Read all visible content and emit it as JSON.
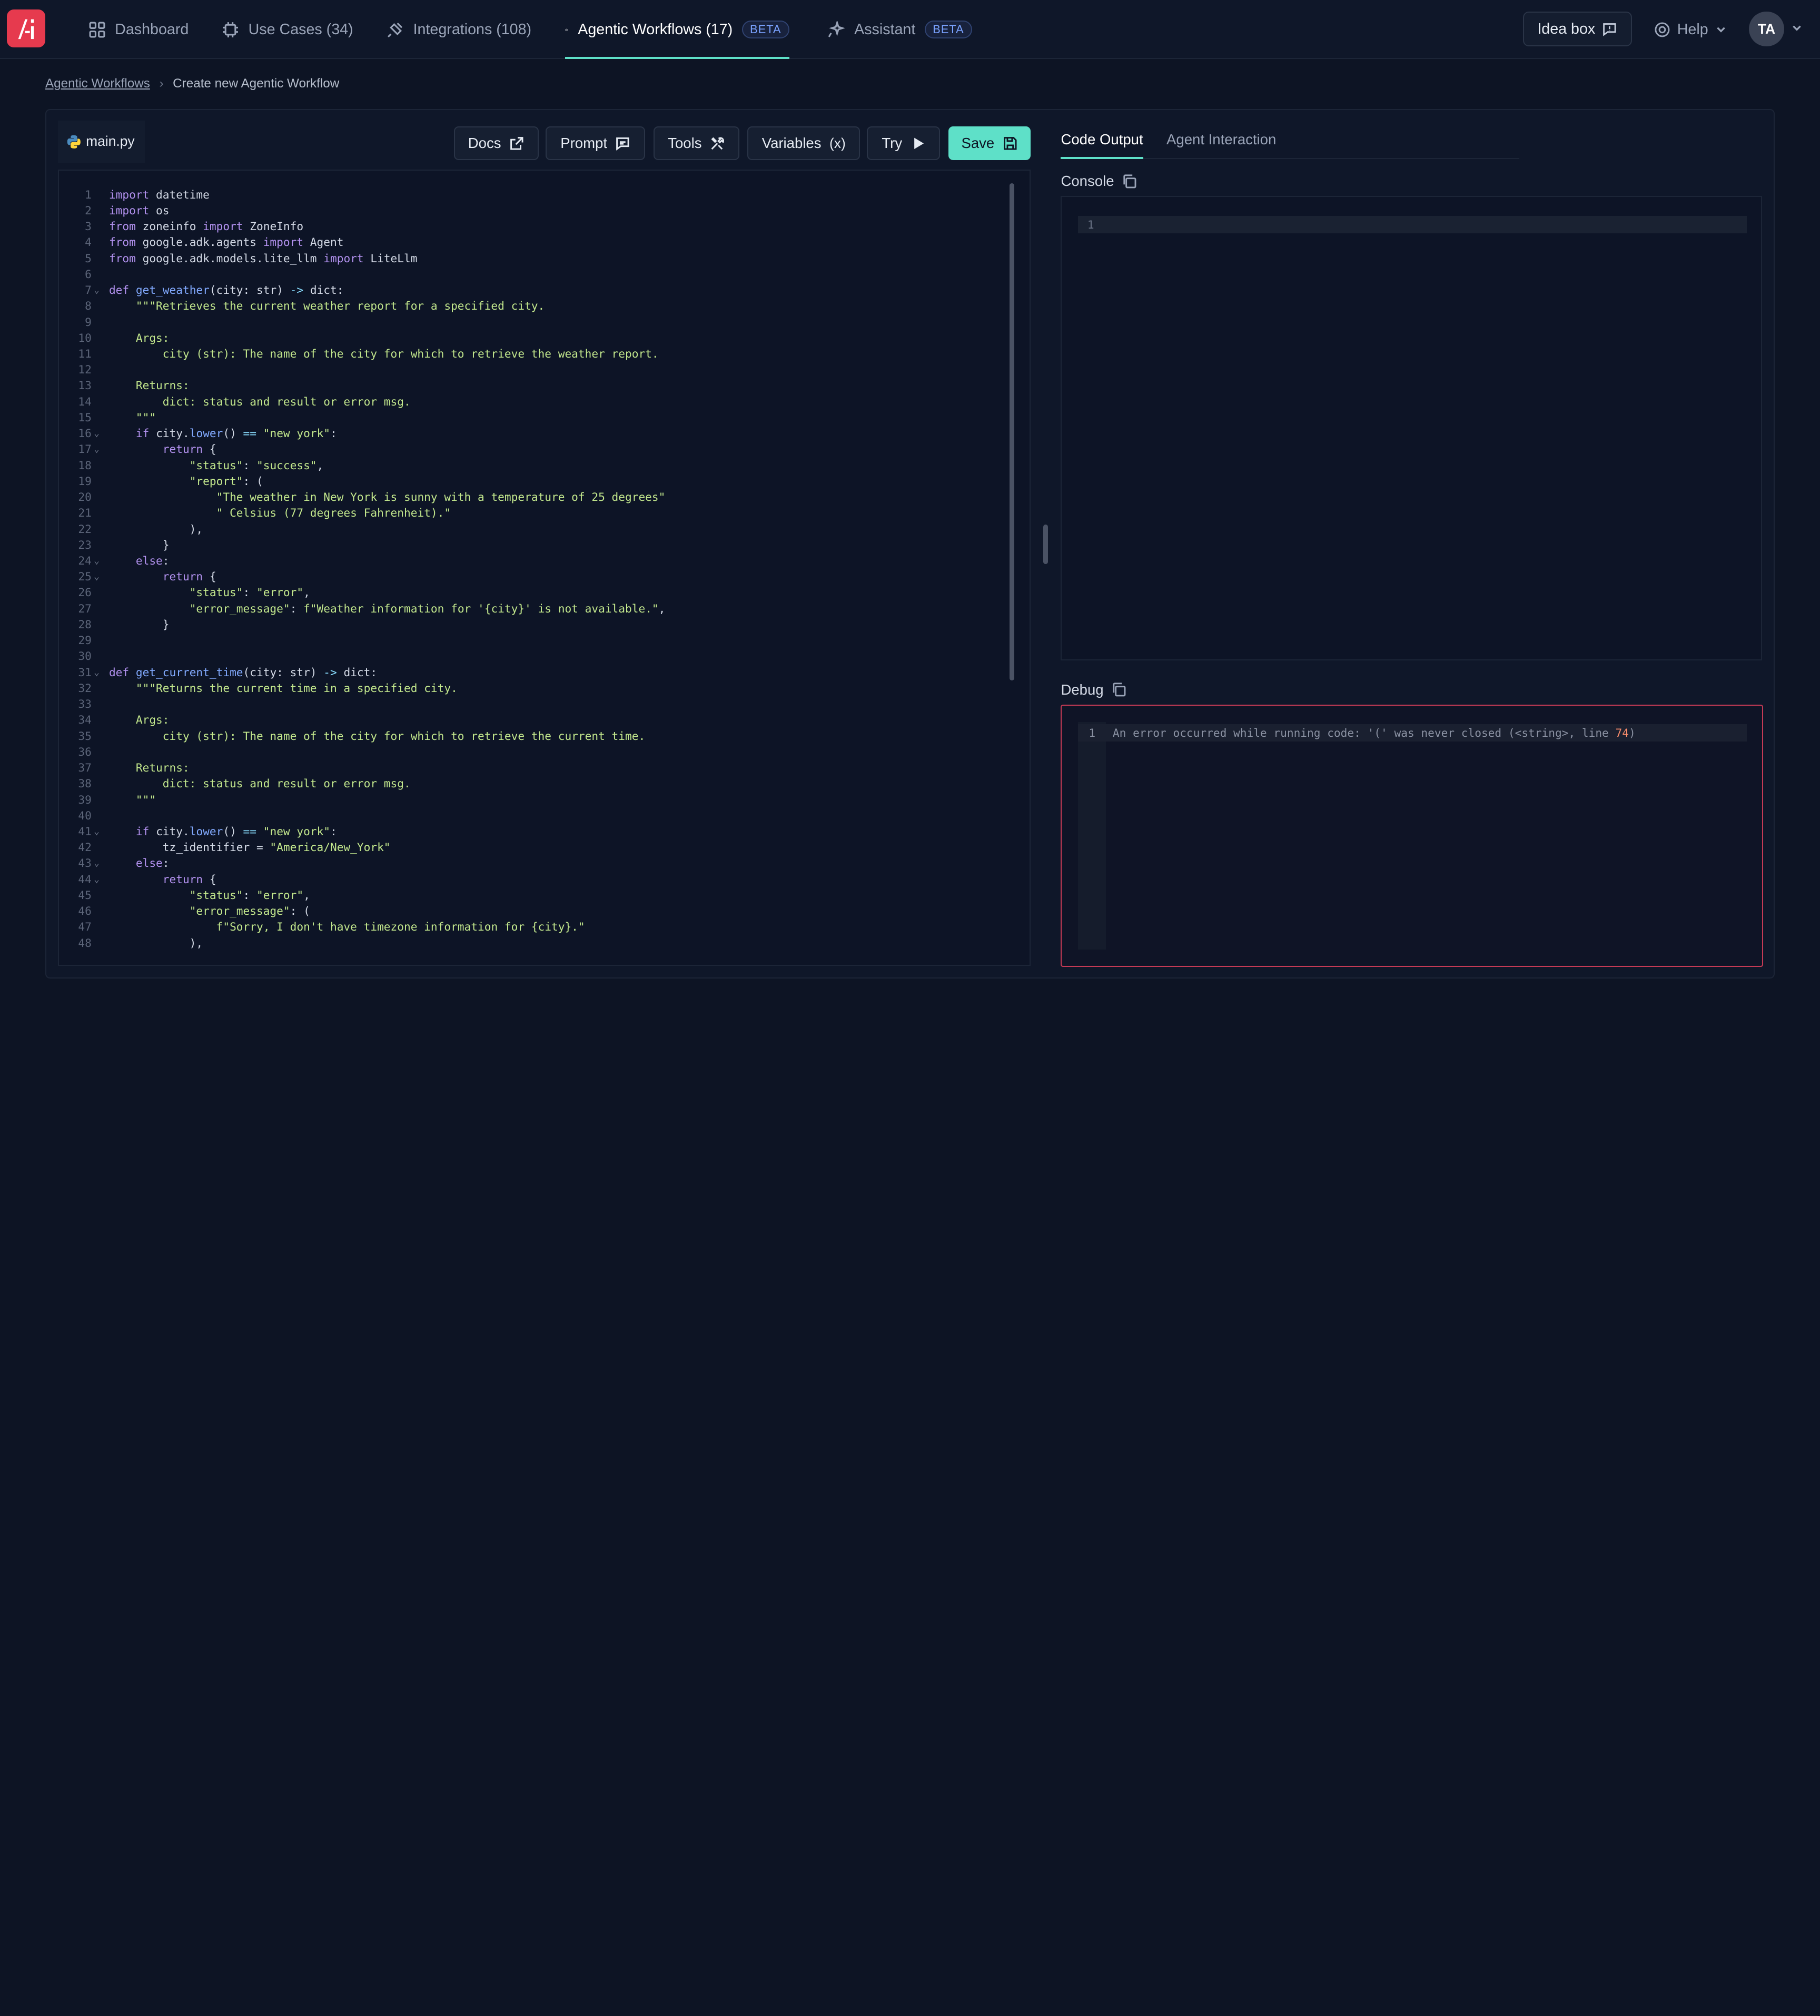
{
  "nav": {
    "tabs": [
      {
        "label": "Dashboard",
        "icon": "dashboard-icon"
      },
      {
        "label": "Use Cases (34)",
        "icon": "chip-icon"
      },
      {
        "label": "Integrations (108)",
        "icon": "plug-icon"
      },
      {
        "label": "Agentic Workflows (17)",
        "icon": "robot-icon",
        "badge": "BETA",
        "active": true
      },
      {
        "label": "Assistant",
        "icon": "sparkle-icon",
        "badge": "BETA"
      }
    ],
    "idea_box": "Idea box",
    "help": "Help",
    "avatar": "TA"
  },
  "breadcrumb": {
    "parent": "Agentic Workflows",
    "current": "Create new Agentic Workflow"
  },
  "editor": {
    "file_name": "main.py",
    "toolbar": {
      "docs": "Docs",
      "prompt": "Prompt",
      "tools": "Tools",
      "variables": "Variables",
      "variables_icon": "(x)",
      "try": "Try",
      "save": "Save"
    },
    "lines": [
      "import datetime",
      "import os",
      "from zoneinfo import ZoneInfo",
      "from google.adk.agents import Agent",
      "from google.adk.models.lite_llm import LiteLlm",
      "",
      "def get_weather(city: str) -> dict:",
      "    \"\"\"Retrieves the current weather report for a specified city.",
      "",
      "    Args:",
      "        city (str): The name of the city for which to retrieve the weather report.",
      "",
      "    Returns:",
      "        dict: status and result or error msg.",
      "    \"\"\"",
      "    if city.lower() == \"new york\":",
      "        return {",
      "            \"status\": \"success\",",
      "            \"report\": (",
      "                \"The weather in New York is sunny with a temperature of 25 degrees\"",
      "                \" Celsius (77 degrees Fahrenheit).\"",
      "            ),",
      "        }",
      "    else:",
      "        return {",
      "            \"status\": \"error\",",
      "            \"error_message\": f\"Weather information for '{city}' is not available.\",",
      "        }",
      "",
      "",
      "def get_current_time(city: str) -> dict:",
      "    \"\"\"Returns the current time in a specified city.",
      "",
      "    Args:",
      "        city (str): The name of the city for which to retrieve the current time.",
      "",
      "    Returns:",
      "        dict: status and result or error msg.",
      "    \"\"\"",
      "",
      "    if city.lower() == \"new york\":",
      "        tz_identifier = \"America/New_York\"",
      "    else:",
      "        return {",
      "            \"status\": \"error\",",
      "            \"error_message\": (",
      "                f\"Sorry, I don't have timezone information for {city}.\"",
      "            ),"
    ],
    "fold_lines": [
      7,
      16,
      17,
      24,
      25,
      31,
      41,
      43,
      44
    ]
  },
  "output": {
    "tabs": [
      {
        "label": "Code Output",
        "active": true
      },
      {
        "label": "Agent Interaction",
        "active": false
      }
    ],
    "console_label": "Console",
    "console_lines": [
      ""
    ],
    "debug_label": "Debug",
    "debug_line_prefix": "An error occurred while running code: '(' was never closed (<string>, line ",
    "debug_line_number": "74",
    "debug_line_suffix": ")"
  },
  "colors": {
    "accent": "#5ee0c8",
    "brand": "#e63a4e",
    "error_border": "#c43a55"
  }
}
